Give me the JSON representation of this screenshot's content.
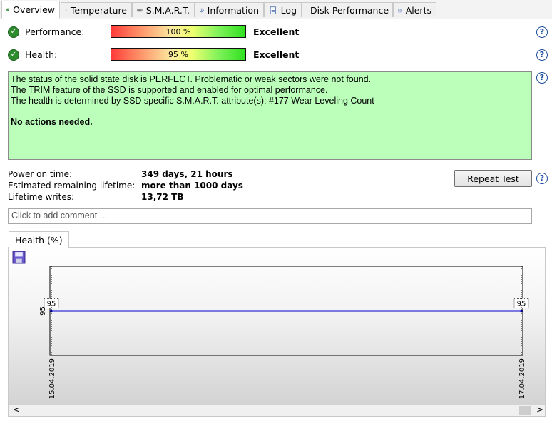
{
  "tabs": [
    {
      "label": "Overview",
      "icon": "check-circle-icon"
    },
    {
      "label": "Temperature",
      "icon": "thermometer-icon"
    },
    {
      "label": "S.M.A.R.T.",
      "icon": "disk-icon"
    },
    {
      "label": "Information",
      "icon": "info-icon"
    },
    {
      "label": "Log",
      "icon": "log-icon"
    },
    {
      "label": "Disk Performance",
      "icon": "speedometer-icon"
    },
    {
      "label": "Alerts",
      "icon": "alerts-icon"
    }
  ],
  "performance": {
    "label": "Performance:",
    "value_text": "100 %",
    "value": 100,
    "rating": "Excellent"
  },
  "health": {
    "label": "Health:",
    "value_text": "95 %",
    "value": 95,
    "rating": "Excellent"
  },
  "status": {
    "line1": "The status of the solid state disk is PERFECT. Problematic or weak sectors were not found.",
    "line2": "The TRIM feature of the SSD is supported and enabled for optimal performance.",
    "line3": "The health is determined by SSD specific S.M.A.R.T. attribute(s):  #177 Wear Leveling Count",
    "action": "No actions needed."
  },
  "info": {
    "power_on_label": "Power on time:",
    "power_on_value": "349 days, 21 hours",
    "remaining_label": "Estimated remaining lifetime:",
    "remaining_value": "more than 1000 days",
    "writes_label": "Lifetime writes:",
    "writes_value": "13,72 TB"
  },
  "repeat_button": "Repeat Test",
  "comment": {
    "placeholder": "Click to add comment ..."
  },
  "chart_tab": "Health (%)",
  "help_glyph": "?",
  "check_glyph": "✓",
  "scroll": {
    "left": "<",
    "right": ">"
  },
  "chart_data": {
    "type": "line",
    "title": "Health (%)",
    "x": [
      "15.04.2019",
      "17.04.2019"
    ],
    "series": [
      {
        "values": [
          95,
          95
        ]
      }
    ],
    "data_labels": [
      "95",
      "95"
    ],
    "ytick": "95",
    "line_color": "#0000cc"
  }
}
